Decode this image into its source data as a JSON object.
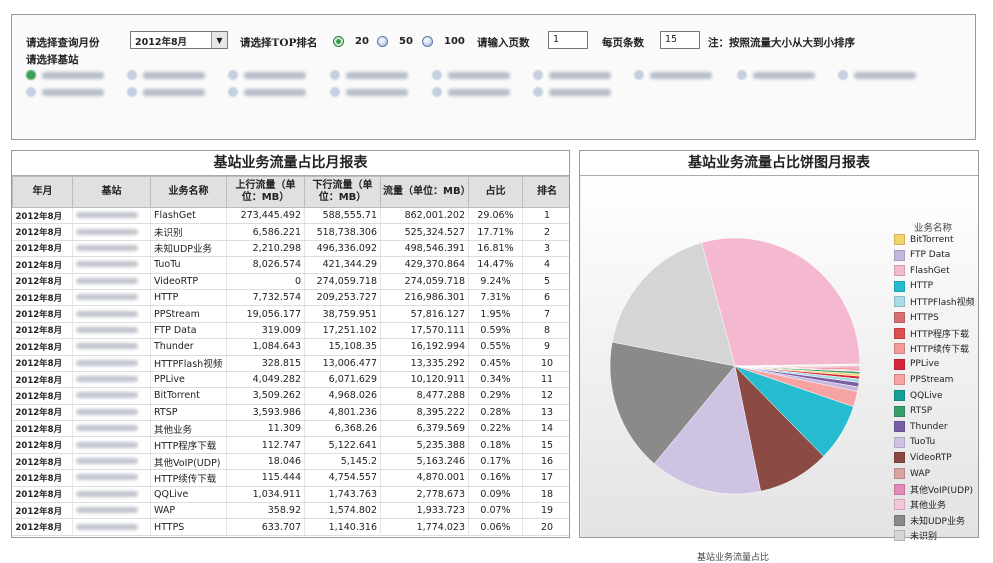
{
  "filters": {
    "month_label": "请选择查询月份",
    "month_value": "2012年8月",
    "top_label": "请选择TOP排名",
    "top_options": [
      "20",
      "50",
      "100"
    ],
    "top_selected": "20",
    "page_label": "请输入页数",
    "page_value": "1",
    "page_size_label": "每页条数",
    "page_size_value": "15",
    "note": "注：按照流量大小从大到小排序",
    "station_label": "请选择基站"
  },
  "table": {
    "title": "基站业务流量占比月报表",
    "headers": [
      "年月",
      "基站",
      "业务名称",
      "上行流量（单位：MB）",
      "下行流量（单位：MB）",
      "流量（单位：MB）",
      "占比",
      "排名"
    ],
    "rows": [
      [
        "2012年8月",
        "FlashGet",
        "273,445.492",
        "588,555.71",
        "862,001.202",
        "29.06%",
        "1"
      ],
      [
        "2012年8月",
        "未识别",
        "6,586.221",
        "518,738.306",
        "525,324.527",
        "17.71%",
        "2"
      ],
      [
        "2012年8月",
        "未知UDP业务",
        "2,210.298",
        "496,336.092",
        "498,546.391",
        "16.81%",
        "3"
      ],
      [
        "2012年8月",
        "TuoTu",
        "8,026.574",
        "421,344.29",
        "429,370.864",
        "14.47%",
        "4"
      ],
      [
        "2012年8月",
        "VideoRTP",
        "0",
        "274,059.718",
        "274,059.718",
        "9.24%",
        "5"
      ],
      [
        "2012年8月",
        "HTTP",
        "7,732.574",
        "209,253.727",
        "216,986.301",
        "7.31%",
        "6"
      ],
      [
        "2012年8月",
        "PPStream",
        "19,056.177",
        "38,759.951",
        "57,816.127",
        "1.95%",
        "7"
      ],
      [
        "2012年8月",
        "FTP Data",
        "319.009",
        "17,251.102",
        "17,570.111",
        "0.59%",
        "8"
      ],
      [
        "2012年8月",
        "Thunder",
        "1,084.643",
        "15,108.35",
        "16,192.994",
        "0.55%",
        "9"
      ],
      [
        "2012年8月",
        "HTTPFlash视频",
        "328.815",
        "13,006.477",
        "13,335.292",
        "0.45%",
        "10"
      ],
      [
        "2012年8月",
        "PPLive",
        "4,049.282",
        "6,071.629",
        "10,120.911",
        "0.34%",
        "11"
      ],
      [
        "2012年8月",
        "BitTorrent",
        "3,509.262",
        "4,968.026",
        "8,477.288",
        "0.29%",
        "12"
      ],
      [
        "2012年8月",
        "RTSP",
        "3,593.986",
        "4,801.236",
        "8,395.222",
        "0.28%",
        "13"
      ],
      [
        "2012年8月",
        "其他业务",
        "11.309",
        "6,368.26",
        "6,379.569",
        "0.22%",
        "14"
      ],
      [
        "2012年8月",
        "HTTP程序下载",
        "112.747",
        "5,122.641",
        "5,235.388",
        "0.18%",
        "15"
      ],
      [
        "2012年8月",
        "其他VoIP(UDP)",
        "18.046",
        "5,145.2",
        "5,163.246",
        "0.17%",
        "16"
      ],
      [
        "2012年8月",
        "HTTP续传下载",
        "115.444",
        "4,754.557",
        "4,870.001",
        "0.16%",
        "17"
      ],
      [
        "2012年8月",
        "QQLive",
        "1,034.911",
        "1,743.763",
        "2,778.673",
        "0.09%",
        "18"
      ],
      [
        "2012年8月",
        "WAP",
        "358.92",
        "1,574.802",
        "1,933.723",
        "0.07%",
        "19"
      ],
      [
        "2012年8月",
        "HTTPS",
        "633.707",
        "1,140.316",
        "1,774.023",
        "0.06%",
        "20"
      ]
    ]
  },
  "pie": {
    "title": "基站业务流量占比饼图月报表",
    "legend_title": "业务名称",
    "caption": "基站业务流量占比",
    "legend": [
      {
        "name": "BitTorrent",
        "color": "#f2d36b"
      },
      {
        "name": "FTP Data",
        "color": "#c5b8dc"
      },
      {
        "name": "FlashGet",
        "color": "#f4b8d0"
      },
      {
        "name": "HTTP",
        "color": "#25bcd0"
      },
      {
        "name": "HTTPFlash视频",
        "color": "#a8dbe6"
      },
      {
        "name": "HTTPS",
        "color": "#d96e72"
      },
      {
        "name": "HTTP程序下载",
        "color": "#e04d4d"
      },
      {
        "name": "HTTP续传下载",
        "color": "#f59a9a"
      },
      {
        "name": "PPLive",
        "color": "#d6263a"
      },
      {
        "name": "PPStream",
        "color": "#f7a3a3"
      },
      {
        "name": "QQLive",
        "color": "#159e96"
      },
      {
        "name": "RTSP",
        "color": "#3a9d6a"
      },
      {
        "name": "Thunder",
        "color": "#7b5fa6"
      },
      {
        "name": "TuoTu",
        "color": "#cfc3e3"
      },
      {
        "name": "VideoRTP",
        "color": "#8b4a44"
      },
      {
        "name": "WAP",
        "color": "#d9a3a0"
      },
      {
        "name": "其他VoIP(UDP)",
        "color": "#e58ab8"
      },
      {
        "name": "其他业务",
        "color": "#f6c6dc"
      },
      {
        "name": "未知UDP业务",
        "color": "#8a8a8a"
      },
      {
        "name": "未识别",
        "color": "#d5d5d5"
      }
    ]
  },
  "chart_data": {
    "type": "pie",
    "title": "基站业务流量占比饼图月报表",
    "caption": "基站业务流量占比",
    "legend_title": "业务名称",
    "slices": [
      {
        "name": "FlashGet",
        "value": 29.06
      },
      {
        "name": "未识别",
        "value": 17.71
      },
      {
        "name": "未知UDP业务",
        "value": 16.81
      },
      {
        "name": "TuoTu",
        "value": 14.47
      },
      {
        "name": "VideoRTP",
        "value": 9.24
      },
      {
        "name": "HTTP",
        "value": 7.31
      },
      {
        "name": "PPStream",
        "value": 1.95
      },
      {
        "name": "FTP Data",
        "value": 0.59
      },
      {
        "name": "Thunder",
        "value": 0.55
      },
      {
        "name": "HTTPFlash视频",
        "value": 0.45
      },
      {
        "name": "PPLive",
        "value": 0.34
      },
      {
        "name": "BitTorrent",
        "value": 0.29
      },
      {
        "name": "RTSP",
        "value": 0.28
      },
      {
        "name": "其他业务",
        "value": 0.22
      },
      {
        "name": "HTTP程序下载",
        "value": 0.18
      },
      {
        "name": "其他VoIP(UDP)",
        "value": 0.17
      },
      {
        "name": "HTTP续传下载",
        "value": 0.16
      },
      {
        "name": "QQLive",
        "value": 0.09
      },
      {
        "name": "WAP",
        "value": 0.07
      },
      {
        "name": "HTTPS",
        "value": 0.06
      }
    ]
  }
}
